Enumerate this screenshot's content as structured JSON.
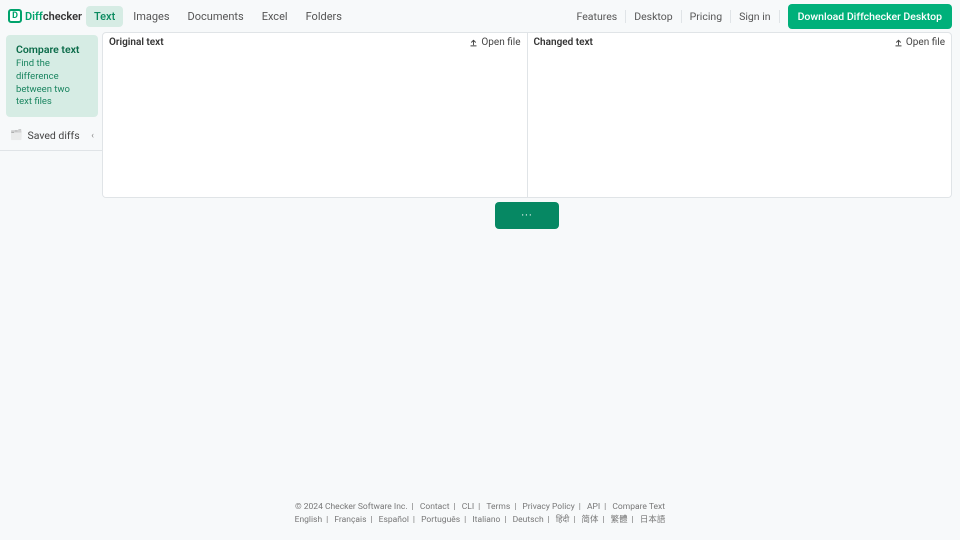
{
  "logo": {
    "mark": "D",
    "part1": "Diff",
    "part2": "checker"
  },
  "nav": {
    "tabs": [
      "Text",
      "Images",
      "Documents",
      "Excel",
      "Folders"
    ],
    "active_index": 0
  },
  "header_right": {
    "links": [
      "Features",
      "Desktop",
      "Pricing",
      "Sign in"
    ],
    "download": "Download Diffchecker Desktop"
  },
  "sidebar": {
    "card": {
      "title": "Compare text",
      "desc": "Find the difference between two text files"
    },
    "saved": {
      "label": "Saved diffs"
    }
  },
  "panes": {
    "left": {
      "title": "Original text",
      "open": "Open file"
    },
    "right": {
      "title": "Changed text",
      "open": "Open file"
    }
  },
  "compare_button": "···",
  "footer": {
    "links": [
      "© 2024 Checker Software Inc.",
      "Contact",
      "CLI",
      "Terms",
      "Privacy Policy",
      "API",
      "Compare Text"
    ],
    "langs": [
      "English",
      "Français",
      "Español",
      "Português",
      "Italiano",
      "Deutsch",
      "हिंदी",
      "简体",
      "繁體",
      "日本語"
    ]
  }
}
